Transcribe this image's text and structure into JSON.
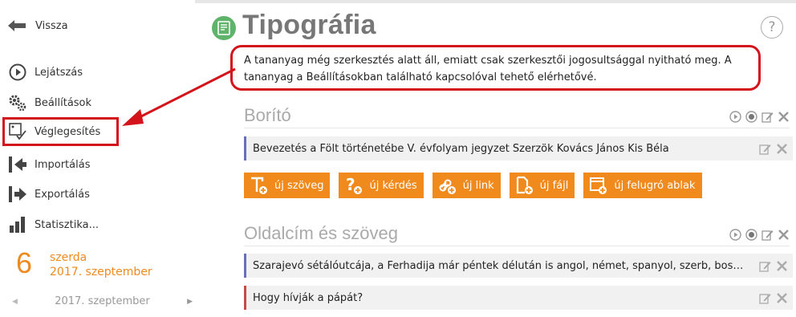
{
  "sidebar": {
    "back_label": "Vissza",
    "items": [
      {
        "label": "Lejátszás",
        "icon": "play-circle-icon"
      },
      {
        "label": "Beállítások",
        "icon": "gears-icon"
      },
      {
        "label": "Véglegesítés",
        "icon": "finalize-icon"
      },
      {
        "label": "Importálás",
        "icon": "import-icon"
      },
      {
        "label": "Exportálás",
        "icon": "export-icon"
      },
      {
        "label": "Statisztika...",
        "icon": "bar-chart-icon"
      }
    ],
    "date": {
      "day": "6",
      "weekday": "szerda",
      "full": "2017. szeptember"
    },
    "month_nav": {
      "month": "2017. szeptember"
    }
  },
  "header": {
    "title": "Tipográfia",
    "help": "?"
  },
  "notice": "A tananyag még szerkesztés alatt áll, emiatt csak szerkesztői jogosultsággal nyitható meg. A tananyag a Beállításokban található kapcsolóval tehető elérhetővé.",
  "sections": [
    {
      "title": "Borító",
      "rows": [
        "Bevezetés a Fölt történetébe V. évfolyam jegyzet Szerzök Kovács János Kis Béla"
      ]
    },
    {
      "title": "Oldalcím és szöveg",
      "rows": [
        "Szarajevó sétálóutcája, a Ferhadija már péntek délután is angol, német, spanyol, szerb, bosnyák, horvát és olasz nyelvtől hangos",
        "Hogy hívják a pápát?"
      ]
    }
  ],
  "buttons": [
    {
      "label": "új szöveg",
      "icon": "add-text-icon"
    },
    {
      "label": "új kérdés",
      "icon": "add-question-icon"
    },
    {
      "label": "új link",
      "icon": "add-link-icon"
    },
    {
      "label": "új fájl",
      "icon": "add-file-icon"
    },
    {
      "label": "új felugró ablak",
      "icon": "add-popup-icon"
    }
  ],
  "colors": {
    "accent": "#f08a1c",
    "highlight": "#d3141b",
    "title_icon": "#5fb36b"
  }
}
